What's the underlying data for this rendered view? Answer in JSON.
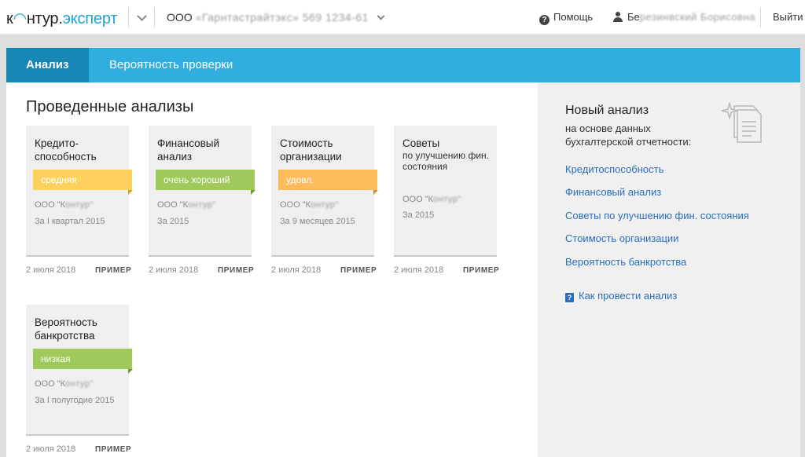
{
  "header": {
    "logo_prefix": "к",
    "logo_mid": "нтур",
    "logo_dot": ".",
    "logo_suffix": "эксперт",
    "org_prefix": "ООО",
    "org_redacted": "«Гарнтастрайтэкс» 569 1234-61",
    "help_label": "Помощь",
    "user_prefix": "Бе",
    "user_redacted": "резинвский Борисовна",
    "logout_label": "Выйти"
  },
  "tabs": [
    {
      "label": "Анализ",
      "active": true
    },
    {
      "label": "Вероятность проверки",
      "active": false
    }
  ],
  "main": {
    "title": "Проведенные анализы",
    "cards": [
      {
        "title": "Кредито-способность",
        "subtitle": "",
        "badge": "средняя",
        "badge_color": "#fdd15c",
        "org_prefix": "ООО \"К",
        "org_redacted": "онтур\"",
        "period": "За I квартал 2015",
        "date": "2 июля 2018",
        "tag": "ПРИМЕР"
      },
      {
        "title": "Финансовый анализ",
        "subtitle": "",
        "badge": "очень хороший",
        "badge_color": "#9fc95a",
        "org_prefix": "ООО \"К",
        "org_redacted": "онтур\"",
        "period": "За 2015",
        "date": "2 июля 2018",
        "tag": "ПРИМЕР"
      },
      {
        "title": "Стоимость организации",
        "subtitle": "",
        "badge": "удовл.",
        "badge_color": "#fdbb5c",
        "org_prefix": "ООО \"К",
        "org_redacted": "онтур\"",
        "period": "За 9 месяцев 2015",
        "date": "2 июля 2018",
        "tag": "ПРИМЕР"
      },
      {
        "title": "Советы",
        "subtitle": "по улучшению фин. состояния",
        "badge": "",
        "badge_color": "",
        "org_prefix": "ООО \"К",
        "org_redacted": "онтур\"",
        "period": "За 2015",
        "date": "2 июля 2018",
        "tag": "ПРИМЕР"
      },
      {
        "title": "Вероятность банкротства",
        "subtitle": "",
        "badge": "низкая",
        "badge_color": "#9fc95a",
        "org_prefix": "ООО \"К",
        "org_redacted": "онтур\"",
        "period": "За I полугодие 2015",
        "date": "2 июля 2018",
        "tag": "ПРИМЕР"
      }
    ]
  },
  "sidebar": {
    "title": "Новый анализ",
    "subtitle": "на основе данных бухгалтерской отчетности:",
    "links": [
      "Кредитоспособность",
      "Финансовый анализ",
      "Советы по улучшению фин. состояния",
      "Стоимость организации",
      "Вероятность банкротства"
    ],
    "howto": "Как провести анализ"
  },
  "colors": {
    "accent": "#31aee0",
    "tab_active": "#1687b5",
    "link": "#2a6ebb"
  }
}
